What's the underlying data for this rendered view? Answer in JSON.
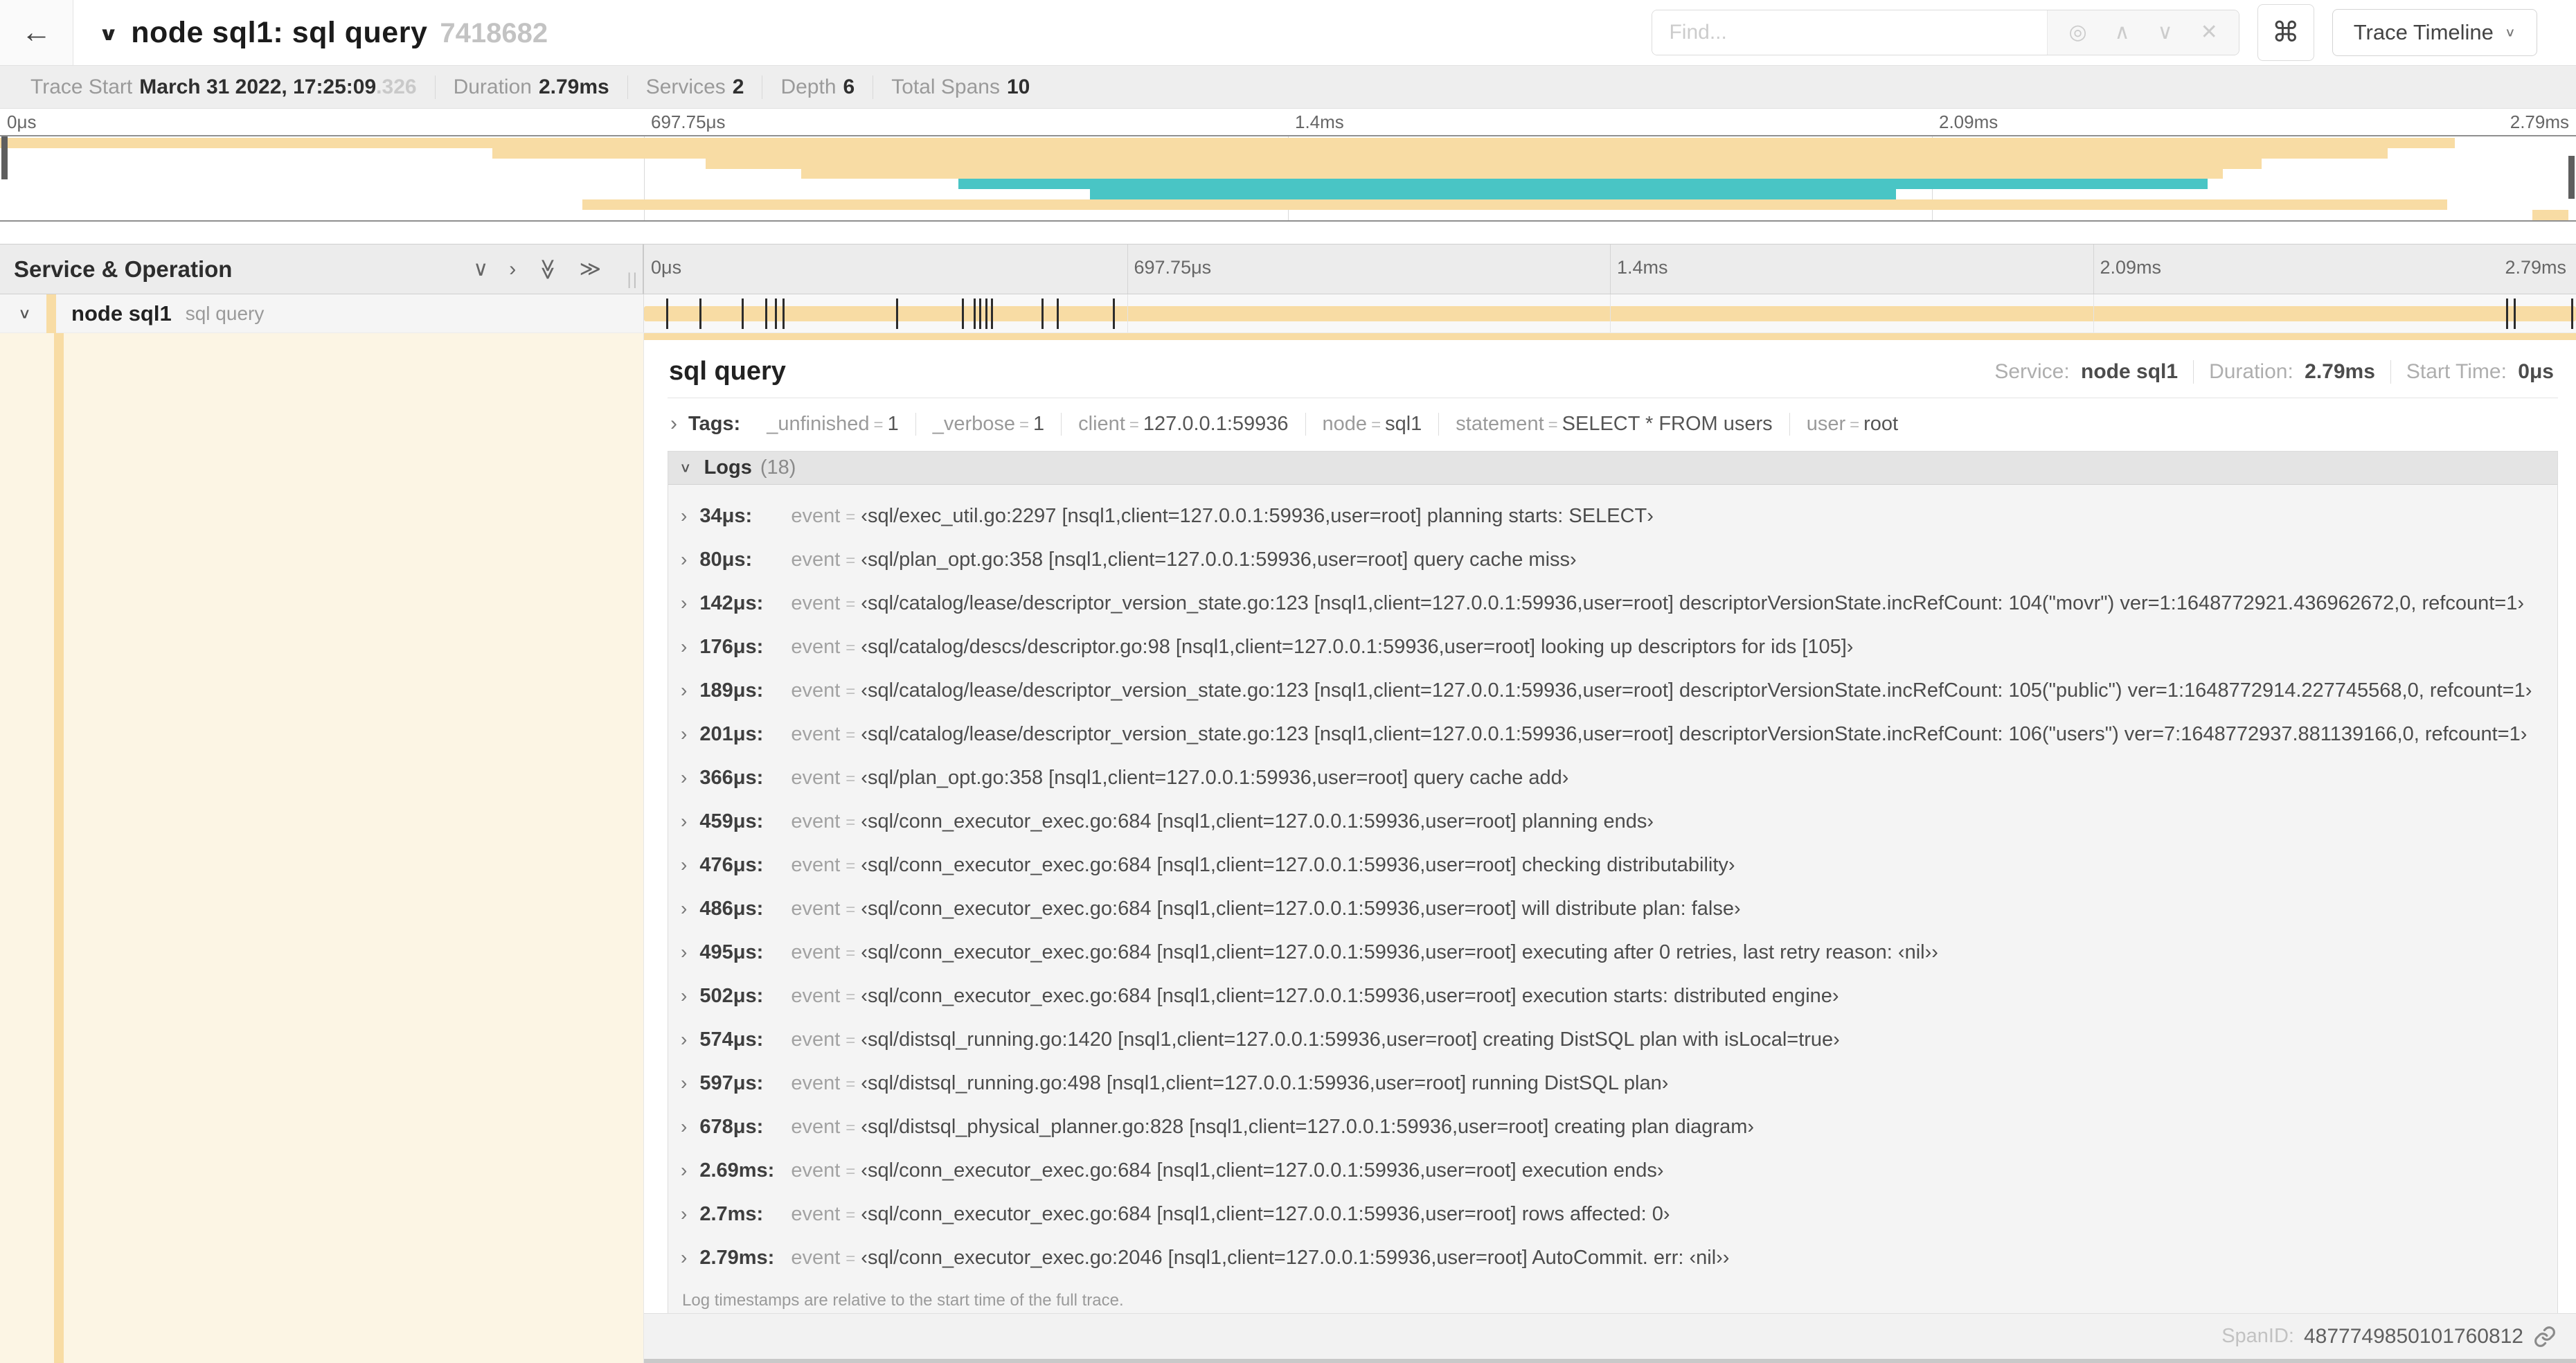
{
  "colors": {
    "tan": "#f8dca4",
    "tan_tint": "#fcf5e4",
    "teal": "#49c5c5",
    "mark": "#2c2c2c"
  },
  "header": {
    "back_icon": "←",
    "collapse_icon": "∨",
    "title": "node sql1: sql query",
    "trace_id_short": "7418682",
    "find_placeholder": "Find...",
    "addon_icons": [
      "◎",
      "∧",
      "∨",
      "✕"
    ],
    "shortcut_label": "⌘",
    "view_selector_label": "Trace Timeline",
    "view_selector_caret": "∨"
  },
  "trace_info": [
    {
      "label": "Trace Start",
      "value": "March 31 2022, 17:25:09",
      "suffix": ".326"
    },
    {
      "label": "Duration",
      "value": "2.79ms",
      "suffix": ""
    },
    {
      "label": "Services",
      "value": "2",
      "suffix": ""
    },
    {
      "label": "Depth",
      "value": "6",
      "suffix": ""
    },
    {
      "label": "Total Spans",
      "value": "10",
      "suffix": ""
    }
  ],
  "ruler_ticks": [
    {
      "label": "0μs",
      "pct": 0
    },
    {
      "label": "697.75μs",
      "pct": 25
    },
    {
      "label": "1.4ms",
      "pct": 50
    },
    {
      "label": "2.09ms",
      "pct": 75
    },
    {
      "label": "2.79ms",
      "pct": 100
    }
  ],
  "minimap": {
    "spans": [
      {
        "color": "tan",
        "start": 0.0,
        "end": 95.3
      },
      {
        "color": "tan",
        "start": 19.1,
        "end": 92.7
      },
      {
        "color": "tan",
        "start": 27.4,
        "end": 87.8
      },
      {
        "color": "tan",
        "start": 31.1,
        "end": 86.3
      },
      {
        "color": "teal",
        "start": 37.2,
        "end": 85.7
      },
      {
        "color": "teal",
        "start": 42.3,
        "end": 73.6
      },
      {
        "color": "tan",
        "start": 22.6,
        "end": 95.0
      },
      {
        "color": "tan",
        "start": 98.3,
        "end": 99.7
      }
    ]
  },
  "timeline": {
    "left_header": "Service & Operation",
    "collapse_one_icon": "∨",
    "expand_one_icon": "›",
    "collapse_all_icon": "≫",
    "expand_all_icon": "≫",
    "grip": "||"
  },
  "span_row": {
    "caret": "∨",
    "service": "node sql1",
    "operation": "sql query",
    "log_marks_pct": [
      1.2,
      2.9,
      5.1,
      6.3,
      6.8,
      7.2,
      13.1,
      16.5,
      17.1,
      17.4,
      17.7,
      18.0,
      20.6,
      21.4,
      24.3,
      96.4,
      96.8,
      99.8
    ]
  },
  "detail": {
    "title": "sql query",
    "meta": [
      {
        "label": "Service:",
        "value": "node sql1"
      },
      {
        "label": "Duration:",
        "value": "2.79ms"
      },
      {
        "label": "Start Time:",
        "value": "0μs"
      }
    ],
    "tags_caret": "›",
    "tags_label": "Tags:",
    "tags": [
      {
        "key": "_unfinished",
        "value": "1"
      },
      {
        "key": "_verbose",
        "value": "1"
      },
      {
        "key": "client",
        "value": "127.0.0.1:59936"
      },
      {
        "key": "node",
        "value": "sql1"
      },
      {
        "key": "statement",
        "value": "SELECT * FROM users"
      },
      {
        "key": "user",
        "value": "root"
      }
    ],
    "logs_caret": "∨",
    "logs_title": "Logs",
    "logs_count": "(18)",
    "log_field": "event",
    "logs": [
      {
        "time": "34μs:",
        "value": "‹sql/exec_util.go:2297 [nsql1,client=127.0.0.1:59936,user=root] planning starts: SELECT›"
      },
      {
        "time": "80μs:",
        "value": "‹sql/plan_opt.go:358 [nsql1,client=127.0.0.1:59936,user=root] query cache miss›"
      },
      {
        "time": "142μs:",
        "value": "‹sql/catalog/lease/descriptor_version_state.go:123 [nsql1,client=127.0.0.1:59936,user=root] descriptorVersionState.incRefCount: 104(\"movr\") ver=1:1648772921.436962672,0, refcount=1›"
      },
      {
        "time": "176μs:",
        "value": "‹sql/catalog/descs/descriptor.go:98 [nsql1,client=127.0.0.1:59936,user=root] looking up descriptors for ids [105]›"
      },
      {
        "time": "189μs:",
        "value": "‹sql/catalog/lease/descriptor_version_state.go:123 [nsql1,client=127.0.0.1:59936,user=root] descriptorVersionState.incRefCount: 105(\"public\") ver=1:1648772914.227745568,0, refcount=1›"
      },
      {
        "time": "201μs:",
        "value": "‹sql/catalog/lease/descriptor_version_state.go:123 [nsql1,client=127.0.0.1:59936,user=root] descriptorVersionState.incRefCount: 106(\"users\") ver=7:1648772937.881139166,0, refcount=1›"
      },
      {
        "time": "366μs:",
        "value": "‹sql/plan_opt.go:358 [nsql1,client=127.0.0.1:59936,user=root] query cache add›"
      },
      {
        "time": "459μs:",
        "value": "‹sql/conn_executor_exec.go:684 [nsql1,client=127.0.0.1:59936,user=root] planning ends›"
      },
      {
        "time": "476μs:",
        "value": "‹sql/conn_executor_exec.go:684 [nsql1,client=127.0.0.1:59936,user=root] checking distributability›"
      },
      {
        "time": "486μs:",
        "value": "‹sql/conn_executor_exec.go:684 [nsql1,client=127.0.0.1:59936,user=root] will distribute plan: false›"
      },
      {
        "time": "495μs:",
        "value": "‹sql/conn_executor_exec.go:684 [nsql1,client=127.0.0.1:59936,user=root] executing after 0 retries, last retry reason: ‹nil››"
      },
      {
        "time": "502μs:",
        "value": "‹sql/conn_executor_exec.go:684 [nsql1,client=127.0.0.1:59936,user=root] execution starts: distributed engine›"
      },
      {
        "time": "574μs:",
        "value": "‹sql/distsql_running.go:1420 [nsql1,client=127.0.0.1:59936,user=root] creating DistSQL plan with isLocal=true›"
      },
      {
        "time": "597μs:",
        "value": "‹sql/distsql_running.go:498 [nsql1,client=127.0.0.1:59936,user=root] running DistSQL plan›"
      },
      {
        "time": "678μs:",
        "value": "‹sql/distsql_physical_planner.go:828 [nsql1,client=127.0.0.1:59936,user=root] creating plan diagram›"
      },
      {
        "time": "2.69ms:",
        "value": "‹sql/conn_executor_exec.go:684 [nsql1,client=127.0.0.1:59936,user=root] execution ends›"
      },
      {
        "time": "2.7ms:",
        "value": "‹sql/conn_executor_exec.go:684 [nsql1,client=127.0.0.1:59936,user=root] rows affected: 0›"
      },
      {
        "time": "2.79ms:",
        "value": "‹sql/conn_executor_exec.go:2046 [nsql1,client=127.0.0.1:59936,user=root] AutoCommit. err: ‹nil››"
      }
    ],
    "logs_note": "Log timestamps are relative to the start time of the full trace.",
    "span_id_label": "SpanID:",
    "span_id": "4877749850101760812"
  }
}
